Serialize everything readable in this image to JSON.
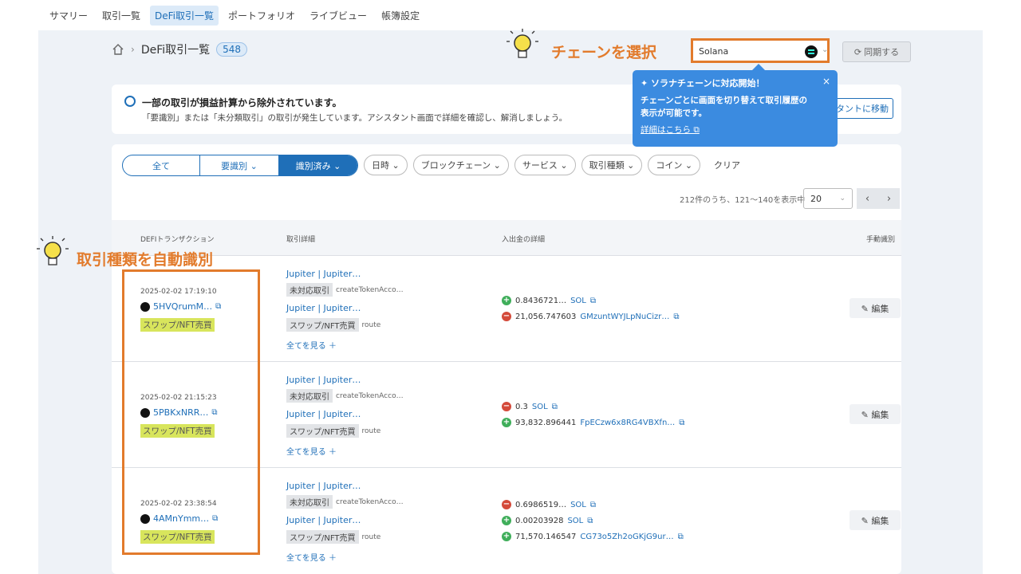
{
  "nav": {
    "items": [
      {
        "label": "サマリー",
        "active": false
      },
      {
        "label": "取引一覧",
        "active": false
      },
      {
        "label": "DeFi取引一覧",
        "active": true
      },
      {
        "label": "ポートフォリオ",
        "active": false
      },
      {
        "label": "ライブビュー",
        "active": false
      },
      {
        "label": "帳簿設定",
        "active": false
      }
    ]
  },
  "breadcrumb": {
    "sep": "›",
    "title": "DeFi取引一覧",
    "count": "548"
  },
  "chain": {
    "value": "Solana",
    "chevron": "⌄",
    "sync_label": "同期する",
    "sync_icon": "⟳"
  },
  "callouts": {
    "chain": "チェーンを選択",
    "auto": "取引種類を自動識別"
  },
  "notice": {
    "title": "一部の取引が損益計算から除外されています。",
    "body": "「要識別」または「未分類取引」の取引が発生しています。アシスタント画面で詳細を確認し、解消しましょう。",
    "button": "タントに移動"
  },
  "tooltip": {
    "title": "✦ ソラナチェーンに対応開始！",
    "close": "×",
    "body_line1": "チェーンごとに画面を切り替えて取引履歴の",
    "body_line2": "表示が可能です。",
    "link": "詳細はこちら ⧉"
  },
  "segments": [
    {
      "label": "全て",
      "on": false
    },
    {
      "label": "要識別 ⌄",
      "on": false
    },
    {
      "label": "識別済み ⌄",
      "on": true
    }
  ],
  "filters": [
    "日時 ⌄",
    "ブロックチェーン ⌄",
    "サービス ⌄",
    "取引種類 ⌄",
    "コイン ⌄"
  ],
  "clear_label": "クリア",
  "pager": {
    "text": "212件のうち、121〜140を表示中",
    "size": "20",
    "size_chev": "⌄",
    "prev": "‹",
    "next": "›"
  },
  "table": {
    "headers": {
      "tx": "DEFIトランザクション",
      "detail": "取引詳細",
      "flow": "入出金の詳細",
      "manual": "手動識別"
    },
    "edit_label": "✎ 編集",
    "ext_icon": "⧉",
    "rows": [
      {
        "date": "2025-02-02 17:19:10",
        "hash": "5HVQrumM…",
        "tag": "スワップ/NFT売買",
        "details": [
          {
            "link": "Jupiter | Jupiter…",
            "tag": "未対応取引",
            "method": "createTokenAcco…"
          },
          {
            "link": "Jupiter | Jupiter…",
            "tag": "スワップ/NFT売買",
            "method": "route"
          }
        ],
        "more": "全てを見る ＋",
        "flows": [
          {
            "dir": "plus",
            "amount": "0.8436721…",
            "symbol": "SOL"
          },
          {
            "dir": "minus",
            "amount": "21,056.747603",
            "symbol": "GMzuntWYJLpNuCizr…"
          }
        ]
      },
      {
        "date": "2025-02-02 21:15:23",
        "hash": "5PBKxNRR…",
        "tag": "スワップ/NFT売買",
        "details": [
          {
            "link": "Jupiter | Jupiter…",
            "tag": "未対応取引",
            "method": "createTokenAcco…"
          },
          {
            "link": "Jupiter | Jupiter…",
            "tag": "スワップ/NFT売買",
            "method": "route"
          }
        ],
        "more": "全てを見る ＋",
        "flows": [
          {
            "dir": "minus",
            "amount": "0.3",
            "symbol": "SOL"
          },
          {
            "dir": "plus",
            "amount": "93,832.896441",
            "symbol": "FpECzw6x8RG4VBXfn…"
          }
        ]
      },
      {
        "date": "2025-02-02 23:38:54",
        "hash": "4AMnYmm…",
        "tag": "スワップ/NFT売買",
        "details": [
          {
            "link": "Jupiter | Jupiter…",
            "tag": "未対応取引",
            "method": "createTokenAcco…"
          },
          {
            "link": "Jupiter | Jupiter…",
            "tag": "スワップ/NFT売買",
            "method": "route"
          }
        ],
        "more": "全てを見る ＋",
        "flows": [
          {
            "dir": "minus",
            "amount": "0.6986519…",
            "symbol": "SOL"
          },
          {
            "dir": "plus",
            "amount": "0.00203928",
            "symbol": "SOL"
          },
          {
            "dir": "plus",
            "amount": "71,570.146547",
            "symbol": "CG73o5Zh2oGKjG9ur…"
          }
        ]
      }
    ]
  }
}
